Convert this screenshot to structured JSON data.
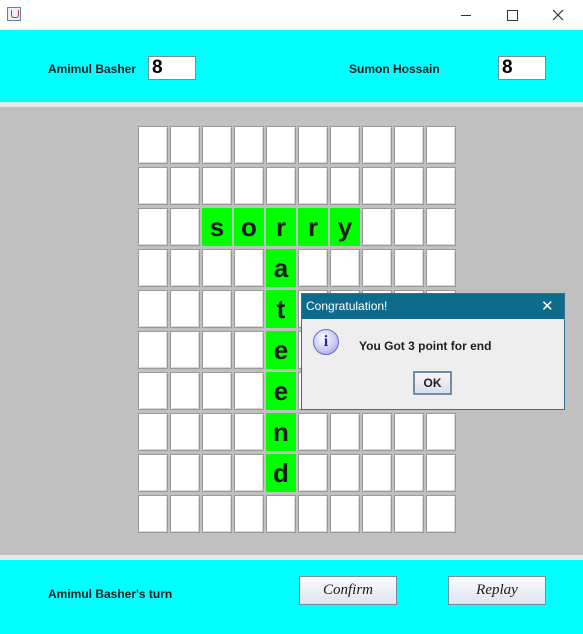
{
  "window": {
    "title": "",
    "minimize_icon": "minimize-icon",
    "maximize_icon": "maximize-icon",
    "close_icon": "close-icon"
  },
  "players": {
    "player1": {
      "name": "Amimul Basher",
      "score": "8"
    },
    "player2": {
      "name": "Sumon Hossain",
      "score": "8"
    }
  },
  "board": {
    "rows": 10,
    "cols": 10,
    "cells": [
      [
        "",
        "",
        "",
        "",
        "",
        "",
        "",
        "",
        "",
        ""
      ],
      [
        "",
        "",
        "",
        "",
        "",
        "",
        "",
        "",
        "",
        ""
      ],
      [
        "",
        "",
        "s",
        "o",
        "r",
        "r",
        "y",
        "",
        "",
        ""
      ],
      [
        "",
        "",
        "",
        "",
        "a",
        "",
        "",
        "",
        "",
        ""
      ],
      [
        "",
        "",
        "",
        "",
        "t",
        "",
        "",
        "",
        "",
        ""
      ],
      [
        "",
        "",
        "",
        "",
        "e",
        "",
        "",
        "",
        "",
        ""
      ],
      [
        "",
        "",
        "",
        "",
        "e",
        "",
        "",
        "",
        "",
        ""
      ],
      [
        "",
        "",
        "",
        "",
        "n",
        "",
        "",
        "",
        "",
        ""
      ],
      [
        "",
        "",
        "",
        "",
        "d",
        "",
        "",
        "",
        "",
        ""
      ],
      [
        "",
        "",
        "",
        "",
        "",
        "",
        "",
        "",
        "",
        ""
      ]
    ],
    "filled_color": "#00ff00"
  },
  "status": {
    "turn": "Amimul Basher's turn"
  },
  "buttons": {
    "confirm": "Confirm",
    "replay": "Replay"
  },
  "dialog": {
    "title": "Congratulation!",
    "message": "You Got 3 point for end",
    "ok": "OK",
    "icon": "info-icon",
    "close_glyph": "✕"
  },
  "colors": {
    "panel": "#00ffff",
    "board_background": "#c0c0c0",
    "dialog_title": "#0e6b8c"
  }
}
